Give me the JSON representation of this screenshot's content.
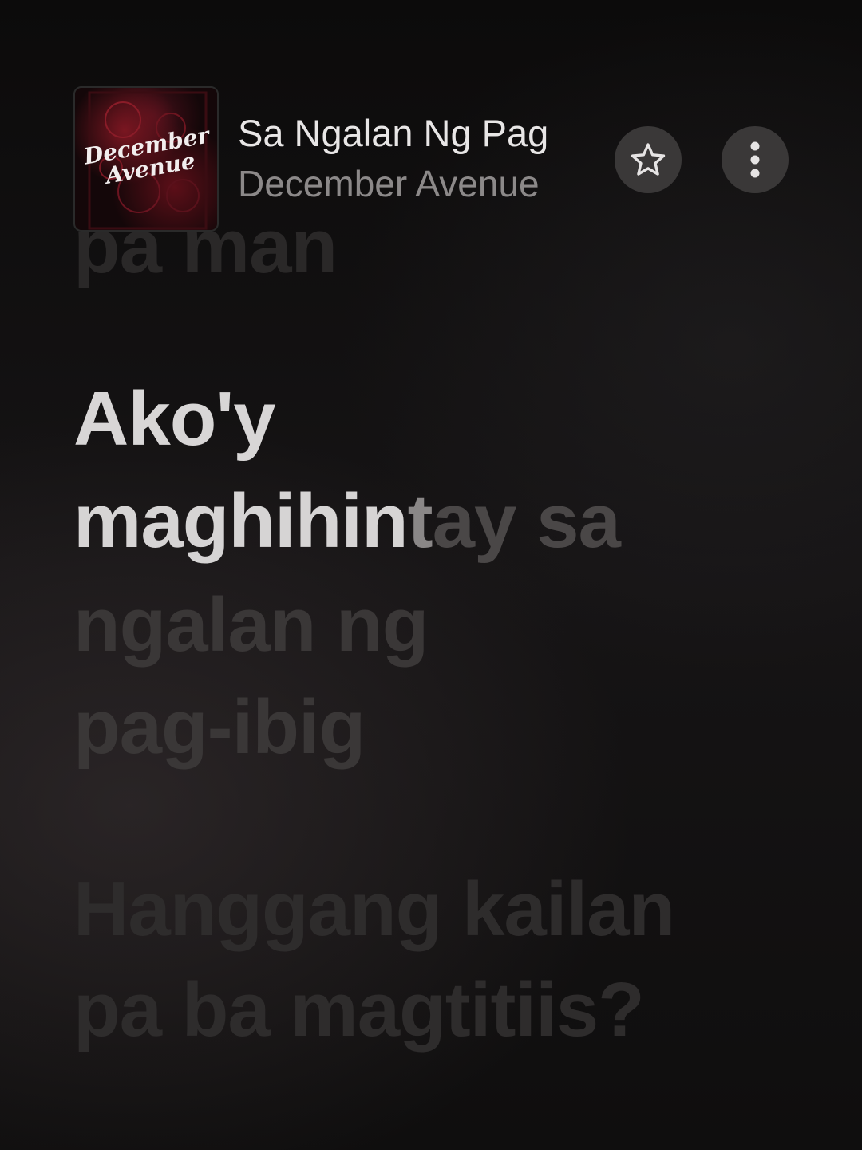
{
  "now_playing": {
    "title": "Sa Ngalan Ng Pag",
    "artist": "December Avenue",
    "artwork_text_line1": "December",
    "artwork_text_line2": "Avenue"
  },
  "actions": {
    "favorite_icon": "star-icon",
    "more_icon": "more-vertical-icon"
  },
  "lyrics": {
    "previous_line_fragment": "pa man",
    "current_line_1": "Ako'y",
    "current_line_2_sung": "maghihin",
    "current_line_2_fade": "t",
    "current_line_2_rest": "ay sa",
    "current_line_3": "ngalan ng",
    "current_line_4": "pag-ibig",
    "next_line_1": "Hanggang kailan",
    "next_line_2": "pa ba magtitiis?"
  },
  "colors": {
    "background": "#111010",
    "active_text": "#d8d6d6",
    "inactive_text": "#3a3737",
    "button_bg": "#3a3838"
  }
}
